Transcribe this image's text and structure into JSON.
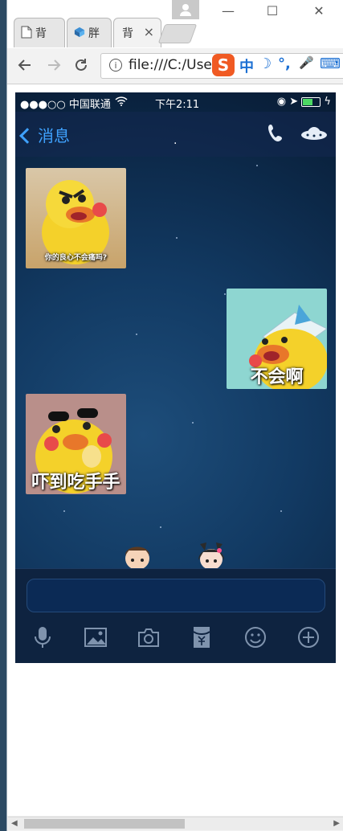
{
  "browser": {
    "tabs": [
      {
        "label": "背",
        "state": "inactive",
        "icon": "document-icon"
      },
      {
        "label": "胖",
        "state": "inactive",
        "icon": "cube-favicon-icon"
      },
      {
        "label": "背",
        "state": "active",
        "icon": "document-icon",
        "close": "×"
      }
    ],
    "window_controls": {
      "minimize": "—",
      "maximize": "☐",
      "close": "✕"
    },
    "url": "file:///C:/Use",
    "ime_toolbar": [
      "中",
      "☽",
      "°,",
      "🎤",
      "⌨"
    ]
  },
  "phone": {
    "status": {
      "carrier": "●●●○○ 中国联通",
      "time": "下午2:11",
      "wifi_icon": "wifi-icon"
    },
    "navbar": {
      "back_label": "消息",
      "title": "."
    },
    "messages": [
      {
        "side": "left",
        "caption": "你的良心不会痛吗?",
        "sticker": "duck-angry"
      },
      {
        "side": "right",
        "caption": "不会啊",
        "sticker": "duck-paper-hat"
      },
      {
        "side": "left",
        "caption": "吓到吃手手",
        "sticker": "duck-scared"
      }
    ],
    "input_placeholder": "",
    "toolbar_icons": [
      "microphone-icon",
      "image-icon",
      "camera-icon",
      "red-packet-icon",
      "emoji-icon",
      "plus-icon"
    ]
  },
  "colors": {
    "accent": "#3fa2ff",
    "chat_bg": "#0e2a4a"
  }
}
